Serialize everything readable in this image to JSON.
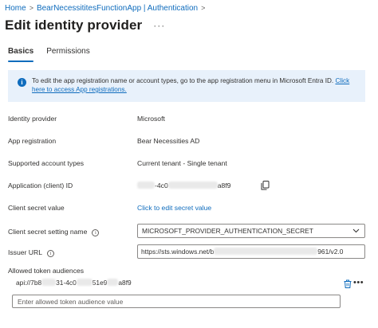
{
  "breadcrumb": {
    "items": [
      "Home",
      "BearNecessititesFunctionApp | Authentication"
    ],
    "separator": ">"
  },
  "header": {
    "title": "Edit identity provider",
    "more": "···"
  },
  "tabs": [
    {
      "label": "Basics",
      "active": true
    },
    {
      "label": "Permissions",
      "active": false
    }
  ],
  "info_banner": {
    "icon": "info-icon",
    "text": "To edit the app registration name or account types, go to the app registration menu in Microsoft Entra ID.",
    "link": "Click here to access App registrations."
  },
  "fields": {
    "identity_provider": {
      "label": "Identity provider",
      "value": "Microsoft"
    },
    "app_registration": {
      "label": "App registration",
      "value": "Bear Necessities AD"
    },
    "account_types": {
      "label": "Supported account types",
      "value": "Current tenant - Single tenant"
    },
    "client_id": {
      "label": "Application (client) ID",
      "value_start": "",
      "value_mid": "-4c0",
      "value_end": "a8f9"
    },
    "client_secret": {
      "label": "Client secret value",
      "link": "Click to edit secret value"
    },
    "secret_setting": {
      "label": "Client secret setting name",
      "value": "MICROSOFT_PROVIDER_AUTHENTICATION_SECRET"
    },
    "issuer_url": {
      "label": "Issuer URL",
      "value_start": "https://sts.windows.net/b",
      "value_end": "961/v2.0"
    }
  },
  "audiences": {
    "label": "Allowed token audiences",
    "items": [
      {
        "prefix": "api://7b8",
        "mid1": "31-4c0",
        "mid2": "51e9",
        "suffix": "a8f9"
      }
    ],
    "placeholder": "Enter allowed token audience value"
  },
  "colors": {
    "accent": "#0f6cbd",
    "banner_bg": "#e8f1fb",
    "text": "#323130",
    "border": "#8a8886"
  }
}
